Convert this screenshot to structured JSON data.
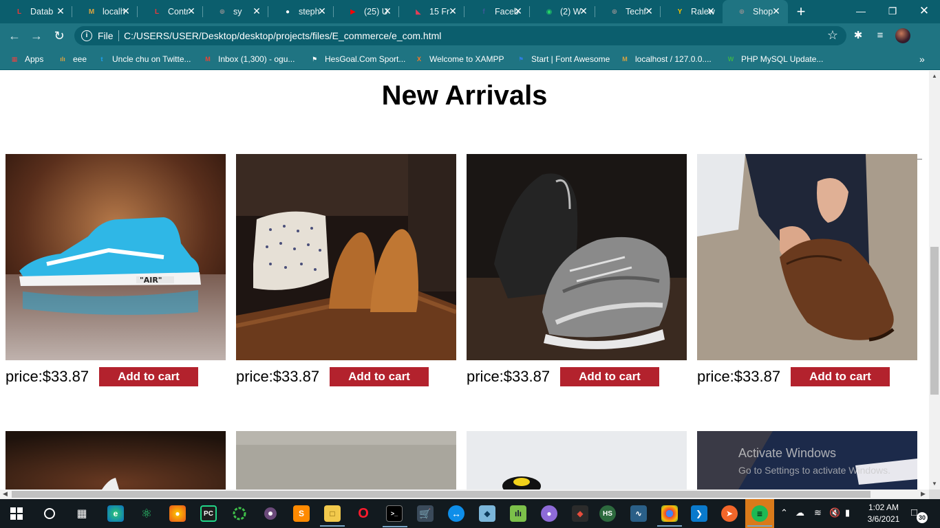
{
  "tabs": [
    {
      "title": "Datab",
      "color": "#e8393b",
      "glyph": "L"
    },
    {
      "title": "localh",
      "color": "#d9a441",
      "glyph": "M"
    },
    {
      "title": "Contr",
      "color": "#e8393b",
      "glyph": "L"
    },
    {
      "title": "sy",
      "color": "#8a8f91",
      "glyph": "⊕"
    },
    {
      "title": "steph",
      "color": "#ffffff",
      "glyph": "●"
    },
    {
      "title": "(25) U",
      "color": "#ff0000",
      "glyph": "▶"
    },
    {
      "title": "15 Fr",
      "color": "#e53e57",
      "glyph": "◣"
    },
    {
      "title": "Faceb",
      "color": "#3b5998",
      "glyph": "f"
    },
    {
      "title": "(2) W",
      "color": "#25d366",
      "glyph": "◉"
    },
    {
      "title": "Techf",
      "color": "#8a8f91",
      "glyph": "⊕"
    },
    {
      "title": "Ralew",
      "color": "#f2c200",
      "glyph": "Y"
    },
    {
      "title": "Shop",
      "color": "#8a8f91",
      "glyph": "⊕",
      "active": true
    }
  ],
  "address": {
    "scheme": "File",
    "url": "C:/USERS/USER/Desktop/desktop/projects/files/E_commerce/e_com.html"
  },
  "bookmarks": [
    {
      "label": "Apps",
      "color": "#e04545",
      "glyph": "▦"
    },
    {
      "label": "eee",
      "color": "#d9a441",
      "glyph": "ılı"
    },
    {
      "label": "Uncle chu on Twitte...",
      "color": "#1da1f2",
      "glyph": "t"
    },
    {
      "label": "Inbox (1,300) - ogu...",
      "color": "#ea4335",
      "glyph": "M"
    },
    {
      "label": "HesGoal.Com Sport...",
      "color": "#ffffff",
      "glyph": "⚑"
    },
    {
      "label": "Welcome to XAMPP",
      "color": "#fb7a24",
      "glyph": "X"
    },
    {
      "label": "Start | Font Awesome",
      "color": "#2d7de0",
      "glyph": "⚑"
    },
    {
      "label": "localhost / 127.0.0....",
      "color": "#d9a441",
      "glyph": "M"
    },
    {
      "label": "PHP MySQL Update...",
      "color": "#3bb34a",
      "glyph": "W"
    }
  ],
  "page": {
    "heading": "New Arrivals",
    "products": [
      {
        "price": "price:$33.87",
        "button": "Add to cart",
        "image": "blue-sneaker"
      },
      {
        "price": "price:$33.87",
        "button": "Add to cart",
        "image": "shirts-and-brown-shoes"
      },
      {
        "price": "price:$33.87",
        "button": "Add to cart",
        "image": "grey-knit-sneakers"
      },
      {
        "price": "price:$33.87",
        "button": "Add to cart",
        "image": "tying-brown-shoe"
      }
    ],
    "watermark": {
      "title": "Activate Windows",
      "subtitle": "Go to Settings to activate Windows."
    }
  },
  "taskbar": {
    "time": "1:02 AM",
    "date": "3/6/2021",
    "notifications": "30"
  }
}
